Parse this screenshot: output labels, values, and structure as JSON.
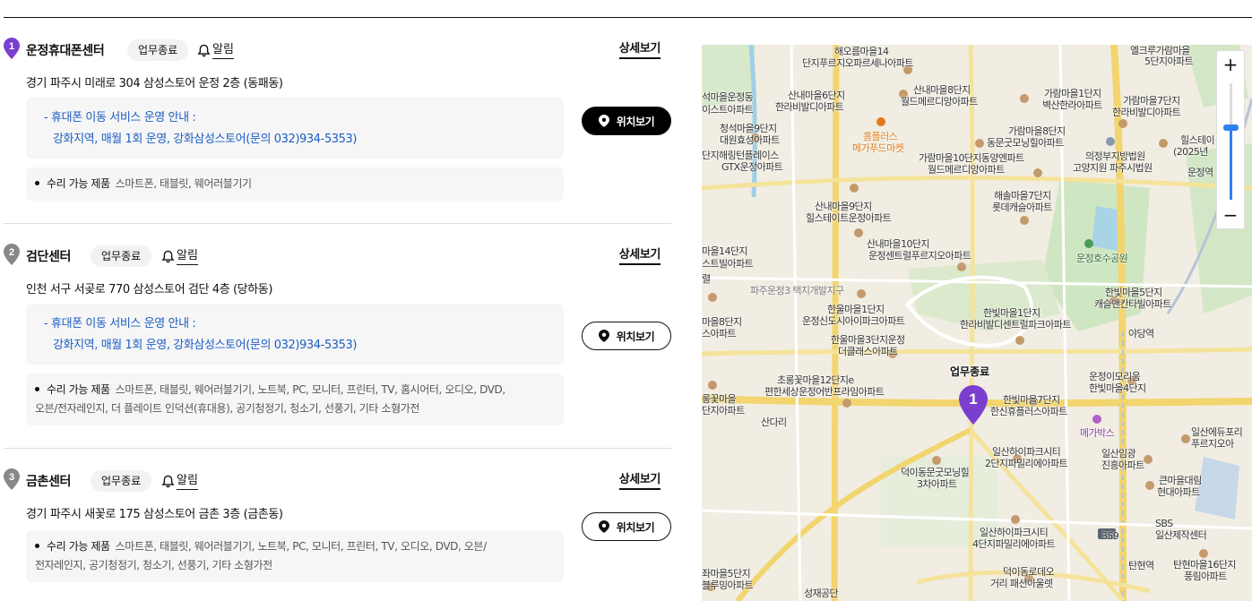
{
  "common": {
    "status_label": "업무종료",
    "alarm_label": "알림",
    "detail_label": "상세보기",
    "location_label": "위치보기",
    "repair_label": "수리 가능 제품"
  },
  "centers": [
    {
      "number": "1",
      "name": "운정휴대폰센터",
      "address": "경기 파주시 미래로 304 삼성스토어 운정 2층 (동패동)",
      "notice_line1": "- 휴대폰 이동 서비스 운영 안내 :",
      "notice_line2": "강화지역, 매월 1회 운영, 강화삼성스토어(문의 032)934-5353)",
      "repair_line1": "스마트폰, 태블릿, 웨어러블기기",
      "repair_line2": "",
      "selected": true,
      "pin_color": "#7b3fd0"
    },
    {
      "number": "2",
      "name": "검단센터",
      "address": "인천 서구 서곶로 770 삼성스토어 검단 4층 (당하동)",
      "notice_line1": "- 휴대폰 이동 서비스 운영 안내 :",
      "notice_line2": "강화지역, 매월 1회 운영, 강화삼성스토어(문의 032)934-5353)",
      "repair_line1": "스마트폰, 태블릿, 웨어러블기기, 노트북, PC, 모니터, 프린터, TV, 홈시어터, 오디오, DVD,",
      "repair_line2": "오븐/전자레인지, 더 플레이트 인덕션(휴대용), 공기청정기, 청소기, 선풍기, 기타 소형가전",
      "selected": false,
      "pin_color": "#888888"
    },
    {
      "number": "3",
      "name": "금촌센터",
      "address": "경기 파주시 새꽃로 175 삼성스토어 금촌 3층 (금촌동)",
      "repair_line1": "스마트폰, 태블릿, 웨어러블기기, 노트북, PC, 모니터, 프린터, TV, 오디오, DVD, 오븐/",
      "repair_line2": "전자레인지, 공기청정기, 청소기, 선풍기, 기타 소형가전",
      "selected": false,
      "pin_color": "#888888"
    }
  ],
  "map": {
    "zoom_in": "+",
    "zoom_out": "−",
    "zoom_level_fraction": 0.62,
    "marker_number": "1",
    "marker_label": "업무종료",
    "labels": [
      "해오름마을14",
      "단지푸르지오파르세나아파트",
      "엘크루가람마을",
      "5단지아파트",
      "석마을운정동",
      "이스트아파트",
      "산내마을6단지",
      "한라비발디아파트",
      "산내마을8단지",
      "월드메르디앙아파트",
      "가람마을1단지",
      "벽산한라아파트",
      "가람마을7단지",
      "한라비발디아파트",
      "청석마을9단지",
      "대원효성아파트",
      "홈플러스",
      "메가푸드마켓",
      "가람마을8단지",
      "동문굿모닝힐아파트",
      "의정부지방법원",
      "고양지원 파주시법원",
      "힐스테이",
      "(2025년",
      "단지해링턴플레이스",
      "GTX운정아파트",
      "가람마을10단지동양엔파트",
      "월드메르디앙아파트",
      "운정역",
      "해솔마을7단지",
      "롯데캐슬아파트",
      "산내마을9단지",
      "힐스테이트운정아파트",
      "산내마을10단지",
      "운정센트럴푸르지오아파트",
      "운정호수공원",
      "마을14단지",
      "스트빌아파트",
      "렬",
      "파주운정3 택지개발지구",
      "한빛마을5단지",
      "캐슬앤칸타빌아파트",
      "한울마을1단지",
      "운정신도시아이파크아파트",
      "한빛마을1단지",
      "한라비발디센트럴파크아파트",
      "마을8단지",
      "스아파트",
      "야당역",
      "한울마을3단지운정",
      "더클래스아파트",
      "운정이모리움",
      "한빛마을4단지",
      "초롱꽃마을12단지e",
      "편한세상운정어반프라임아파트",
      "롱꽃마을",
      "단지아파트",
      "한빛마을7단지",
      "한신휴플러스아파트",
      "산다리",
      "메가박스",
      "일산에듀포리",
      "푸르지오아",
      "일산하이파크시티",
      "2단지파밀리에아파트",
      "일산임광",
      "진흥아파트",
      "덕이동문굿모닝힐",
      "3차아파트",
      "큰마을대림",
      "현대아파트",
      "359",
      "SBS",
      "일산제작센터",
      "일산하이파크시티",
      "4단지파밀리에아파트",
      "좌마을5단지",
      "블루밍아파트",
      "덕이동로데오",
      "거리 패션아울렛",
      "탄현역",
      "탄현마을16단지",
      "풍림아파트",
      "성재공단"
    ]
  }
}
